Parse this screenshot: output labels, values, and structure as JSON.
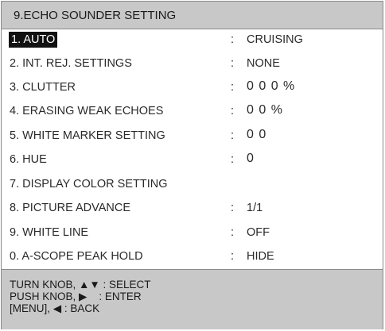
{
  "title": "9.ECHO SOUNDER SETTING",
  "items": [
    {
      "label": "1. AUTO",
      "colon": ":",
      "value": "CRUISING"
    },
    {
      "label": "2. INT. REJ. SETTINGS",
      "colon": ":",
      "value": "NONE"
    },
    {
      "label": "3. CLUTTER",
      "colon": ":",
      "value": "0 0 0 %"
    },
    {
      "label": "4. ERASING WEAK ECHOES",
      "colon": ":",
      "value": "0 0 %"
    },
    {
      "label": "5. WHITE MARKER SETTING",
      "colon": ":",
      "value": "0 0"
    },
    {
      "label": "6. HUE",
      "colon": ":",
      "value": "0"
    },
    {
      "label": "7. DISPLAY COLOR SETTING",
      "colon": "",
      "value": ""
    },
    {
      "label": "8. PICTURE ADVANCE",
      "colon": ":",
      "value": "1/1"
    },
    {
      "label": "9. WHITE LINE",
      "colon": ":",
      "value": "OFF"
    },
    {
      "label": "0. A-SCOPE PEAK HOLD",
      "colon": ":",
      "value": "HIDE"
    }
  ],
  "footer": {
    "line1": "TURN KNOB, ▲▼ : SELECT",
    "line2": "PUSH KNOB, ▶    : ENTER",
    "line3": "[MENU], ◀ : BACK"
  }
}
